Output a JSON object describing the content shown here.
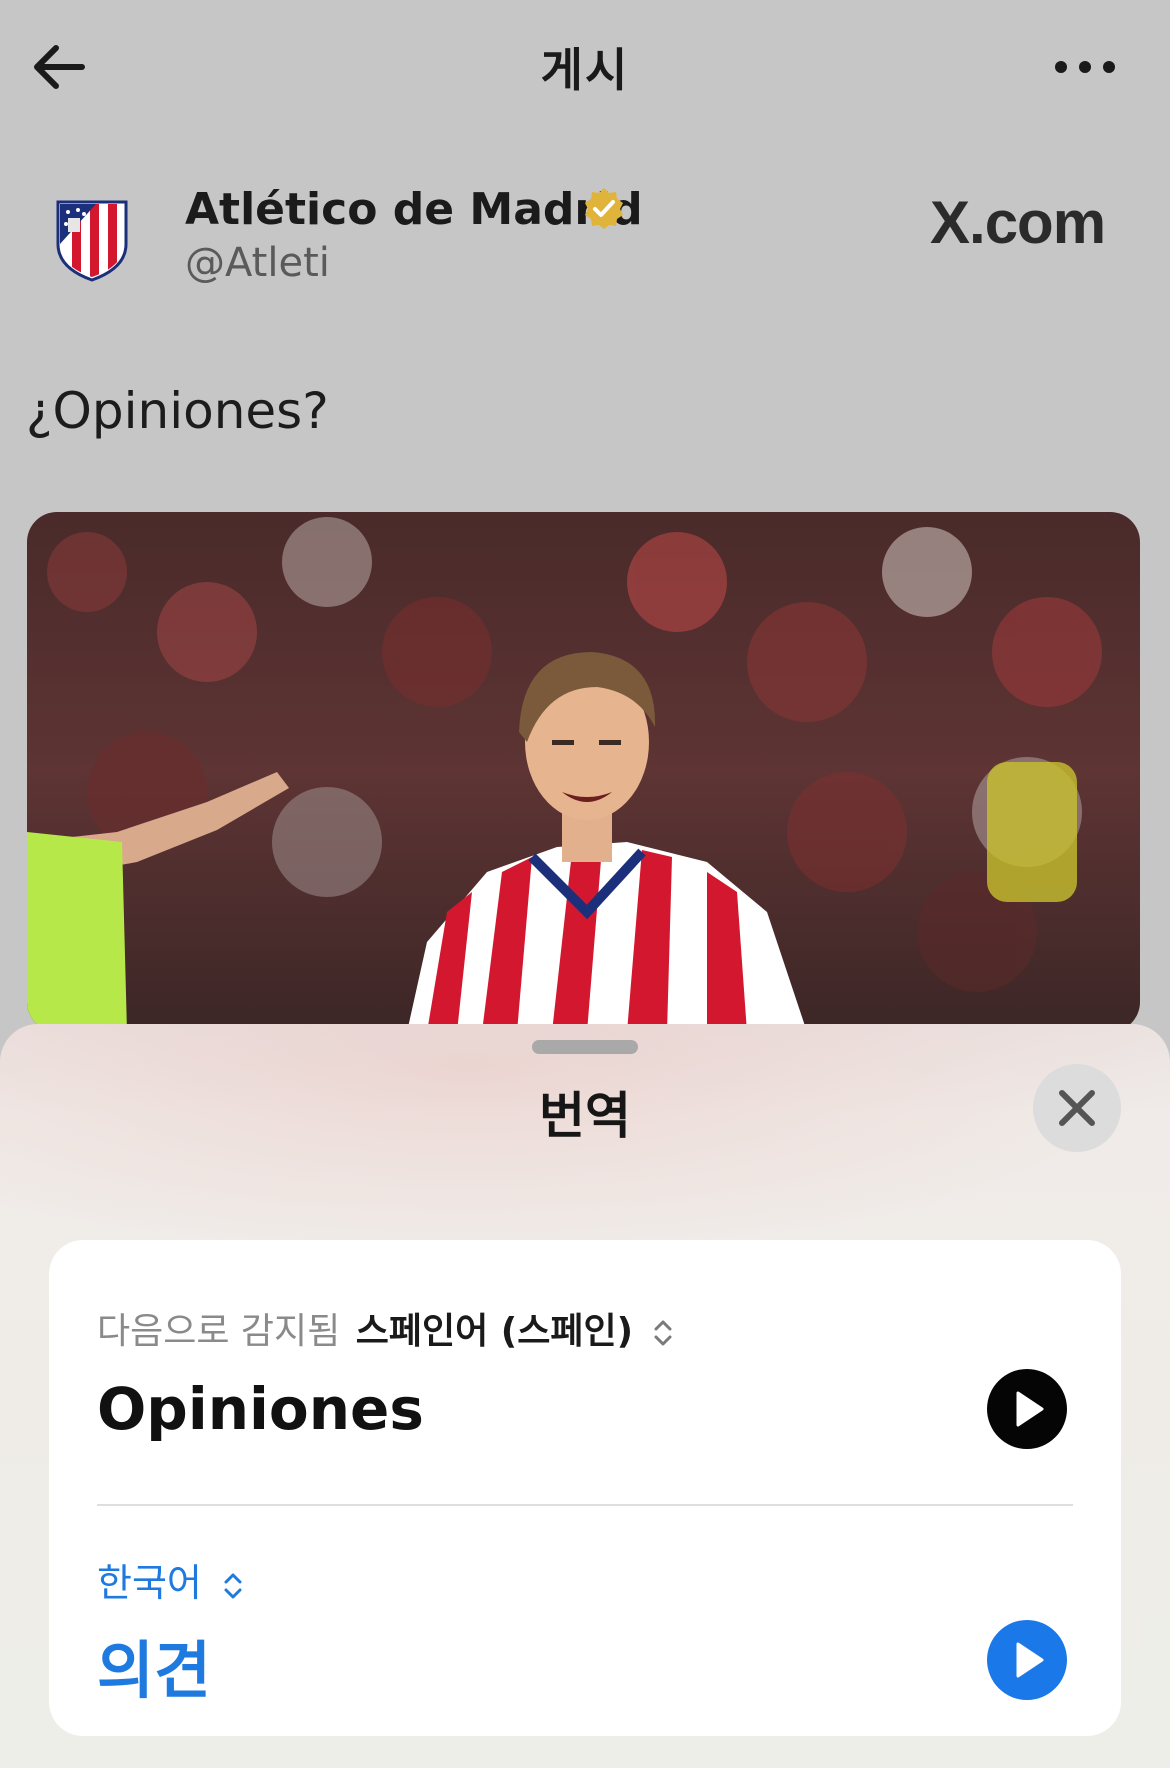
{
  "header": {
    "title": "게시"
  },
  "account": {
    "name": "Atlético de Madrid",
    "handle": "@Atleti"
  },
  "watermark": "X.com",
  "post": {
    "text": "¿Opiniones?"
  },
  "translate_sheet": {
    "title": "번역",
    "detected_prefix": "다음으로 감지됨",
    "detected_language": "스페인어 (스페인)",
    "source_text": "Opiniones",
    "target_language": "한국어",
    "target_text": "의견"
  },
  "icons": {
    "back": "arrow-left-icon",
    "more": "ellipsis-icon",
    "verified": "verified-badge-icon",
    "close": "close-icon",
    "play": "play-icon",
    "language_select": "chevron-up-down-icon"
  },
  "colors": {
    "accent_blue": "#1f7ae0",
    "verified_gold": "#e0b43a",
    "background": "#c6c6c6"
  }
}
